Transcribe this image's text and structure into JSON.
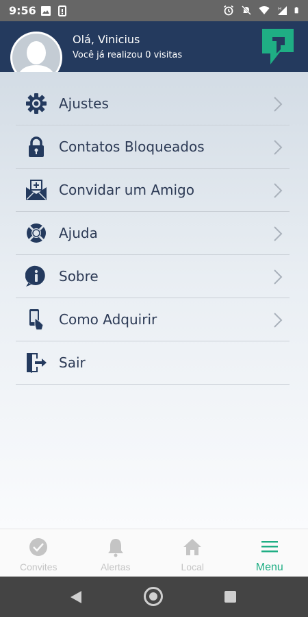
{
  "status_bar": {
    "time": "9:56",
    "left_icons": [
      "image-icon",
      "phone-alert-icon"
    ],
    "right_icons": [
      "alarm-icon",
      "mute-icon",
      "wifi-icon",
      "signal-icon",
      "battery-icon"
    ],
    "network_letter": "H"
  },
  "header": {
    "greeting": "Olá, Vinicius",
    "visits_text": "Você já realizou 0 visitas",
    "avatar_icon": "user-avatar-icon",
    "logo_icon": "app-logo-icon"
  },
  "menu": {
    "items": [
      {
        "label": "Ajustes",
        "icon": "gear-icon",
        "has_chevron": true
      },
      {
        "label": "Contatos Bloqueados",
        "icon": "lock-icon",
        "has_chevron": true
      },
      {
        "label": "Convidar um Amigo",
        "icon": "mail-add-icon",
        "has_chevron": true
      },
      {
        "label": "Ajuda",
        "icon": "lifebuoy-icon",
        "has_chevron": true
      },
      {
        "label": "Sobre",
        "icon": "info-icon",
        "has_chevron": true
      },
      {
        "label": "Como Adquirir",
        "icon": "phone-hand-icon",
        "has_chevron": true
      },
      {
        "label": "Sair",
        "icon": "exit-door-icon",
        "has_chevron": false
      }
    ]
  },
  "bottom_nav": {
    "items": [
      {
        "label": "Convites",
        "icon": "check-circle-icon",
        "active": false
      },
      {
        "label": "Alertas",
        "icon": "bell-icon",
        "active": false
      },
      {
        "label": "Local",
        "icon": "home-icon",
        "active": false
      },
      {
        "label": "Menu",
        "icon": "hamburger-menu-icon",
        "active": true
      }
    ]
  },
  "colors": {
    "header_bg": "#243a5e",
    "accent": "#1fae84",
    "text_dark": "#2c3a55",
    "nav_inactive": "#c4c4c4"
  }
}
